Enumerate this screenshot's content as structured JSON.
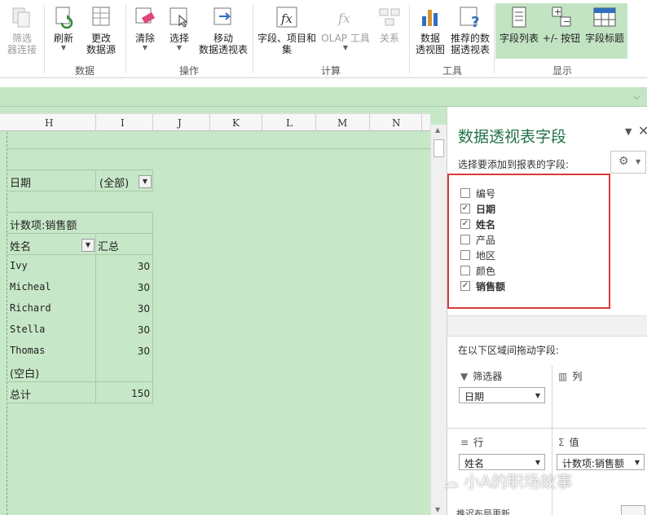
{
  "ribbon": {
    "buttons": [
      {
        "label": "筛选\n器连接",
        "enabled": false
      },
      {
        "label": "刷新",
        "enabled": true
      },
      {
        "label": "更改\n数据源",
        "enabled": true
      },
      {
        "label": "清除",
        "enabled": true
      },
      {
        "label": "选择",
        "enabled": true
      },
      {
        "label": "移动\n数据透视表",
        "enabled": true
      },
      {
        "label": "字段、项目和\n集",
        "enabled": true
      },
      {
        "label": "OLAP 工具",
        "enabled": false
      },
      {
        "label": "关系",
        "enabled": false
      },
      {
        "label": "数据\n透视图",
        "enabled": true
      },
      {
        "label": "推荐的数\n据透视表",
        "enabled": true
      },
      {
        "label": "字段列表",
        "enabled": true
      },
      {
        "label": "+/- 按钮",
        "enabled": true
      },
      {
        "label": "字段标题",
        "enabled": true
      }
    ],
    "groups": [
      "数据",
      "操作",
      "计算",
      "工具",
      "显示"
    ],
    "colors": {
      "show_group_bg": "#c3e4c3"
    }
  },
  "sheet": {
    "columns": [
      "H",
      "I",
      "J",
      "K",
      "L",
      "M",
      "N"
    ],
    "filter": {
      "label": "日期",
      "value": "(全部)"
    },
    "count_label": "计数项:销售额",
    "row_header": "姓名",
    "value_header": "汇总",
    "rows": [
      {
        "name": "Ivy",
        "value": "30"
      },
      {
        "name": "Micheal",
        "value": "30"
      },
      {
        "name": "Richard",
        "value": "30"
      },
      {
        "name": "Stella",
        "value": "30"
      },
      {
        "name": "Thomas",
        "value": "30"
      },
      {
        "name": "(空白)",
        "value": ""
      }
    ],
    "total_label": "总计",
    "total_value": "150",
    "bg_color": "#c7e8c8"
  },
  "pane": {
    "title": "数据透视表字段",
    "instruction": "选择要添加到报表的字段:",
    "fields": [
      {
        "label": "编号",
        "checked": false
      },
      {
        "label": "日期",
        "checked": true
      },
      {
        "label": "姓名",
        "checked": true
      },
      {
        "label": "产品",
        "checked": false
      },
      {
        "label": "地区",
        "checked": false
      },
      {
        "label": "颜色",
        "checked": false
      },
      {
        "label": "销售额",
        "checked": true
      }
    ],
    "areas_instruction": "在以下区域间拖动字段:",
    "areas": {
      "filters": {
        "label": "筛选器",
        "item": "日期"
      },
      "columns": {
        "label": "列"
      },
      "rows": {
        "label": "行",
        "item": "姓名"
      },
      "values": {
        "label": "值",
        "item": "计数项:销售额"
      }
    },
    "bottom_peek": "推迟布局更新"
  },
  "watermark": "小A的职场故事"
}
